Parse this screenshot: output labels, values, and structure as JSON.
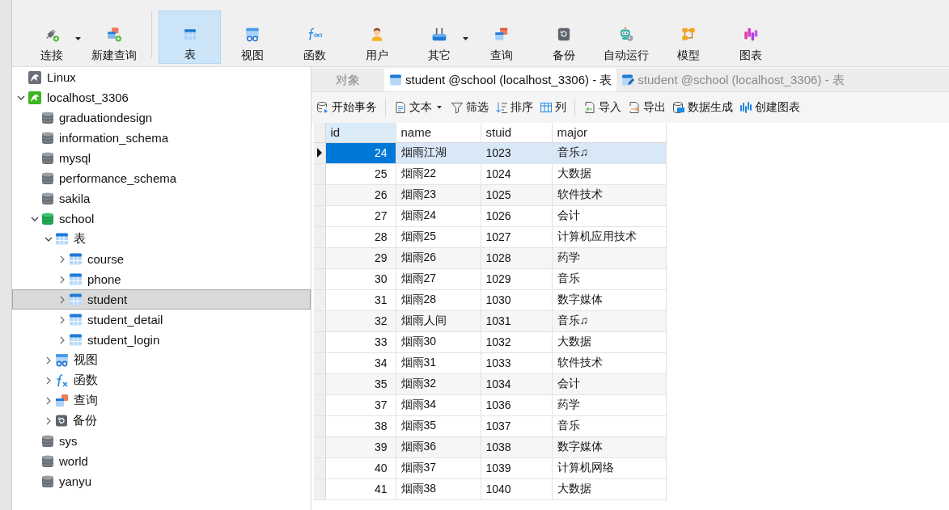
{
  "toolbar": {
    "buttons": [
      {
        "label": "连接",
        "dropdown": true,
        "selected": false
      },
      {
        "label": "新建查询",
        "dropdown": false,
        "selected": false
      },
      {
        "label": "表",
        "dropdown": false,
        "selected": true
      },
      {
        "label": "视图",
        "dropdown": false,
        "selected": false
      },
      {
        "label": "函数",
        "dropdown": false,
        "selected": false
      },
      {
        "label": "用户",
        "dropdown": false,
        "selected": false
      },
      {
        "label": "其它",
        "dropdown": true,
        "selected": false
      },
      {
        "label": "查询",
        "dropdown": false,
        "selected": false
      },
      {
        "label": "备份",
        "dropdown": false,
        "selected": false
      },
      {
        "label": "自动运行",
        "dropdown": false,
        "selected": false
      },
      {
        "label": "模型",
        "dropdown": false,
        "selected": false
      },
      {
        "label": "图表",
        "dropdown": false,
        "selected": false
      }
    ]
  },
  "sidebar": {
    "tree": [
      {
        "label": "Linux",
        "kind": "connection",
        "open": false,
        "selected": false
      },
      {
        "label": "localhost_3306",
        "kind": "connection",
        "open": true,
        "expanded": true,
        "selected": false,
        "children": [
          {
            "label": "graduationdesign",
            "kind": "database",
            "open": false,
            "selected": false
          },
          {
            "label": "information_schema",
            "kind": "database",
            "open": false,
            "selected": false
          },
          {
            "label": "mysql",
            "kind": "database",
            "open": false,
            "selected": false
          },
          {
            "label": "performance_schema",
            "kind": "database",
            "open": false,
            "selected": false
          },
          {
            "label": "sakila",
            "kind": "database",
            "open": false,
            "selected": false
          },
          {
            "label": "school",
            "kind": "database",
            "open": true,
            "expanded": true,
            "selected": false,
            "children": [
              {
                "label": "表",
                "kind": "tables",
                "expanded": true,
                "selected": false,
                "children": [
                  {
                    "label": "course",
                    "kind": "table",
                    "expanded": false,
                    "selected": false
                  },
                  {
                    "label": "phone",
                    "kind": "table",
                    "expanded": false,
                    "selected": false
                  },
                  {
                    "label": "student",
                    "kind": "table",
                    "expanded": false,
                    "selected": true
                  },
                  {
                    "label": "student_detail",
                    "kind": "table",
                    "expanded": false,
                    "selected": false
                  },
                  {
                    "label": "student_login",
                    "kind": "table",
                    "expanded": false,
                    "selected": false
                  }
                ]
              },
              {
                "label": "视图",
                "kind": "views",
                "expanded": false,
                "selected": false
              },
              {
                "label": "函数",
                "kind": "functions",
                "expanded": false,
                "selected": false
              },
              {
                "label": "查询",
                "kind": "queries",
                "expanded": false,
                "selected": false
              },
              {
                "label": "备份",
                "kind": "backups",
                "expanded": false,
                "selected": false
              }
            ]
          },
          {
            "label": "sys",
            "kind": "database",
            "open": false,
            "selected": false
          },
          {
            "label": "world",
            "kind": "database",
            "open": false,
            "selected": false
          },
          {
            "label": "yanyu",
            "kind": "database",
            "open": false,
            "selected": false
          }
        ]
      }
    ]
  },
  "tabs": [
    {
      "label": "对象",
      "kind": "objects",
      "selected": false
    },
    {
      "label": "student @school (localhost_3306) - 表",
      "kind": "table",
      "selected": true
    },
    {
      "label": "student @school (localhost_3306) - 表",
      "kind": "design",
      "selected": false
    }
  ],
  "data_toolbar": {
    "groups": [
      [
        {
          "label": "开始事务",
          "dropdown": false
        }
      ],
      [
        {
          "label": "文本",
          "dropdown": true
        },
        {
          "label": "筛选",
          "dropdown": false
        },
        {
          "label": "排序",
          "dropdown": false
        },
        {
          "label": "列",
          "dropdown": false
        }
      ],
      [
        {
          "label": "导入",
          "dropdown": false
        },
        {
          "label": "导出",
          "dropdown": false
        },
        {
          "label": "数据生成",
          "dropdown": false
        },
        {
          "label": "创建图表",
          "dropdown": false
        }
      ]
    ]
  },
  "table": {
    "columns": [
      {
        "label": "id",
        "selected": true
      },
      {
        "label": "name",
        "selected": false
      },
      {
        "label": "stuid",
        "selected": false
      },
      {
        "label": "major",
        "selected": false
      }
    ],
    "rows": [
      {
        "cells": [
          "24",
          "烟雨江湖",
          "1023",
          "音乐♫"
        ],
        "selected": true
      },
      {
        "cells": [
          "25",
          "烟雨22",
          "1024",
          "大数据"
        ],
        "selected": false
      },
      {
        "cells": [
          "26",
          "烟雨23",
          "1025",
          "软件技术"
        ],
        "selected": false
      },
      {
        "cells": [
          "27",
          "烟雨24",
          "1026",
          "会计"
        ],
        "selected": false
      },
      {
        "cells": [
          "28",
          "烟雨25",
          "1027",
          "计算机应用技术"
        ],
        "selected": false
      },
      {
        "cells": [
          "29",
          "烟雨26",
          "1028",
          "药学"
        ],
        "selected": false
      },
      {
        "cells": [
          "30",
          "烟雨27",
          "1029",
          "音乐"
        ],
        "selected": false
      },
      {
        "cells": [
          "31",
          "烟雨28",
          "1030",
          "数字媒体"
        ],
        "selected": false
      },
      {
        "cells": [
          "32",
          "烟雨人间",
          "1031",
          "音乐♫"
        ],
        "selected": false
      },
      {
        "cells": [
          "33",
          "烟雨30",
          "1032",
          "大数据"
        ],
        "selected": false
      },
      {
        "cells": [
          "34",
          "烟雨31",
          "1033",
          "软件技术"
        ],
        "selected": false
      },
      {
        "cells": [
          "35",
          "烟雨32",
          "1034",
          "会计"
        ],
        "selected": false
      },
      {
        "cells": [
          "37",
          "烟雨34",
          "1036",
          "药学"
        ],
        "selected": false
      },
      {
        "cells": [
          "38",
          "烟雨35",
          "1037",
          "音乐"
        ],
        "selected": false
      },
      {
        "cells": [
          "39",
          "烟雨36",
          "1038",
          "数字媒体"
        ],
        "selected": false
      },
      {
        "cells": [
          "40",
          "烟雨37",
          "1039",
          "计算机网络"
        ],
        "selected": false
      },
      {
        "cells": [
          "41",
          "烟雨38",
          "1040",
          "大数据"
        ],
        "selected": false
      }
    ]
  }
}
